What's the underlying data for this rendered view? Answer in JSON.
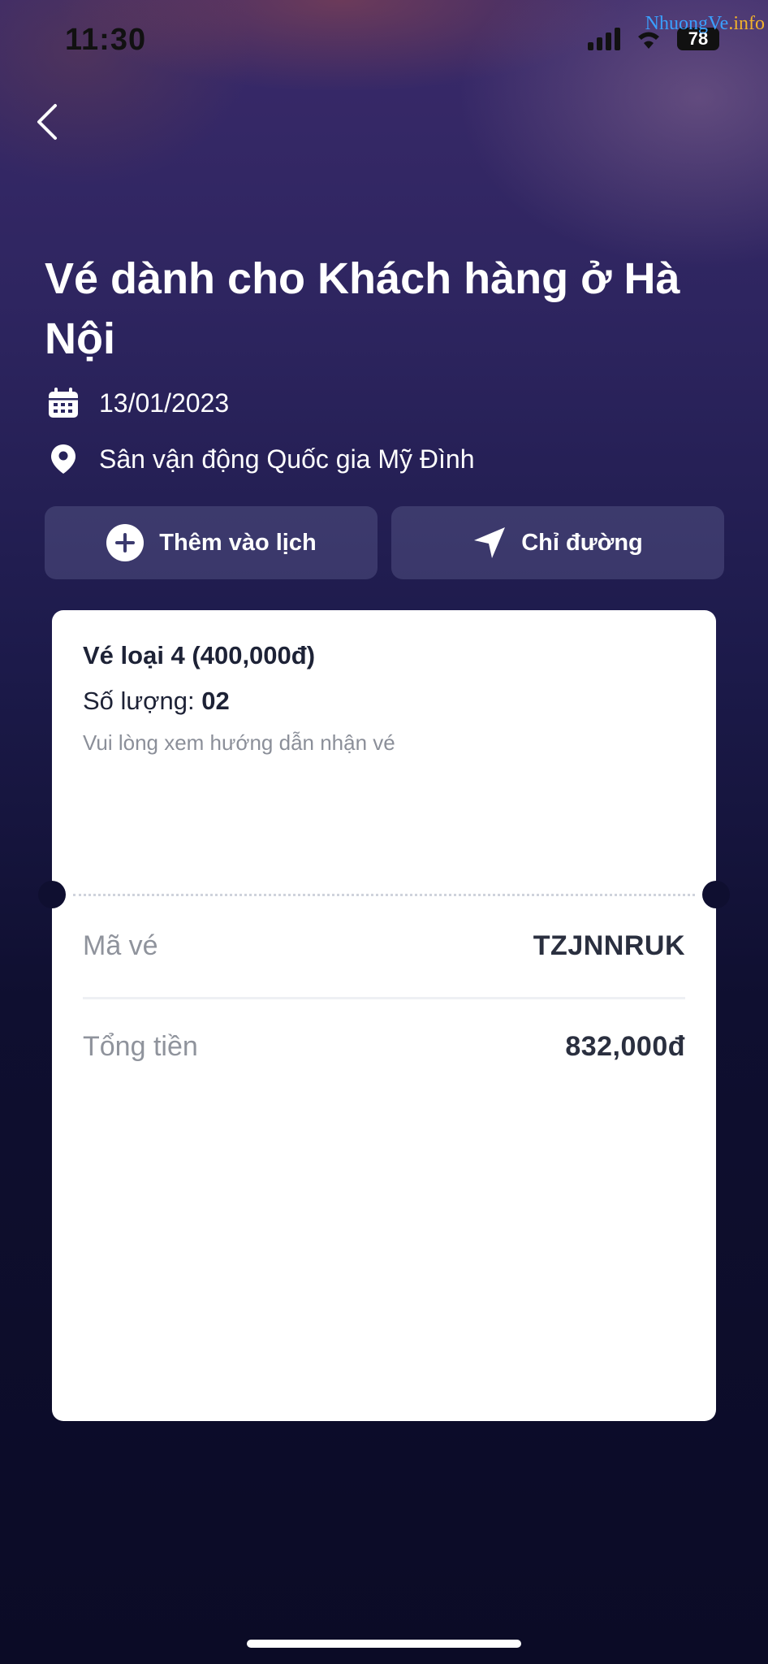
{
  "status_bar": {
    "time": "11:30",
    "battery": "78"
  },
  "watermark": {
    "part1": "NhuongVe",
    "part2": ".info"
  },
  "event": {
    "title": "Vé dành cho Khách hàng ở Hà Nội",
    "date": "13/01/2023",
    "venue": "Sân vận động Quốc gia Mỹ Đình"
  },
  "actions": {
    "add_to_calendar": "Thêm vào lịch",
    "directions": "Chỉ đường"
  },
  "ticket": {
    "type": "Vé loại 4 (400,000đ)",
    "quantity_label": "Số lượng:",
    "quantity_value": "02",
    "note": "Vui lòng xem hướng dẫn nhận vé",
    "code_label": "Mã vé",
    "code_value": "TZJNNRUK",
    "total_label": "Tổng tiền",
    "total_value": "832,000đ"
  },
  "icons": {
    "back": "chevron-left-icon",
    "date": "calendar-icon",
    "venue": "map-pin-icon",
    "add": "plus-circle-icon",
    "directions": "navigation-arrow-icon"
  }
}
